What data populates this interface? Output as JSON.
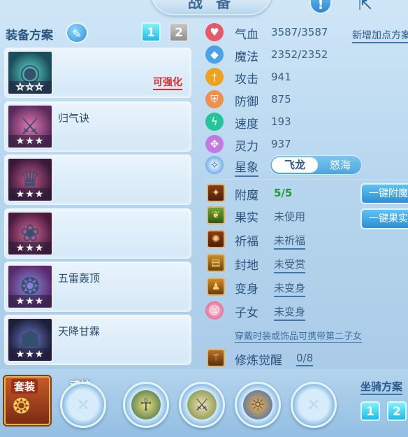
{
  "header": {
    "title": "战 备"
  },
  "equipment": {
    "section_title": "装备方案",
    "plans": [
      "1",
      "2"
    ],
    "slots": [
      {
        "name": "",
        "stars": "☆☆☆",
        "enhance": "可强化"
      },
      {
        "name": "归气诀",
        "stars": "★★★",
        "enhance": ""
      },
      {
        "name": "",
        "stars": "★★★",
        "enhance": ""
      },
      {
        "name": "",
        "stars": "★★★",
        "enhance": ""
      },
      {
        "name": "五雷轰顶",
        "stars": "★★★",
        "enhance": ""
      },
      {
        "name": "天降甘霖",
        "stars": "★★★",
        "enhance": ""
      }
    ]
  },
  "stats": {
    "new_plan_link": "新增加点方案",
    "rows": [
      {
        "label": "气血",
        "value": "3587/3587",
        "icon": "heart-icon",
        "color": "#e8586a"
      },
      {
        "label": "魔法",
        "value": "2352/2352",
        "icon": "mana-icon",
        "color": "#4aa3e8"
      },
      {
        "label": "攻击",
        "value": "941",
        "icon": "attack-icon",
        "color": "#f0a21c"
      },
      {
        "label": "防御",
        "value": "875",
        "icon": "defense-icon",
        "color": "#f09050"
      },
      {
        "label": "速度",
        "value": "193",
        "icon": "speed-icon",
        "color": "#27c49a"
      },
      {
        "label": "灵力",
        "value": "937",
        "icon": "spirit-icon",
        "color": "#c07ae0"
      }
    ],
    "star_label": "星象",
    "star_options": [
      "飞龙",
      "怒海"
    ],
    "enchant_label": "附魔",
    "enchant_value": "5/5",
    "fruit_label": "果实",
    "fruit_value": "未使用",
    "bless_label": "祈福",
    "bless_value": "未祈福",
    "fief_label": "封地",
    "fief_value": "未受赏",
    "transform_label": "变身",
    "transform_value": "未变身",
    "child_label": "子女",
    "child_value": "未变身",
    "child_note": "穿戴时装或饰品可携带第二子女",
    "cultivate_label": "修炼觉醒",
    "cultivate_value": "0/8",
    "btn_enchant": "一键附魔",
    "btn_fruit": "一键果实"
  },
  "bottom": {
    "suit_label": "套装",
    "soul_label": "魂技",
    "mount_title": "坐骑方案",
    "mount_plans": [
      "1",
      "2"
    ]
  }
}
